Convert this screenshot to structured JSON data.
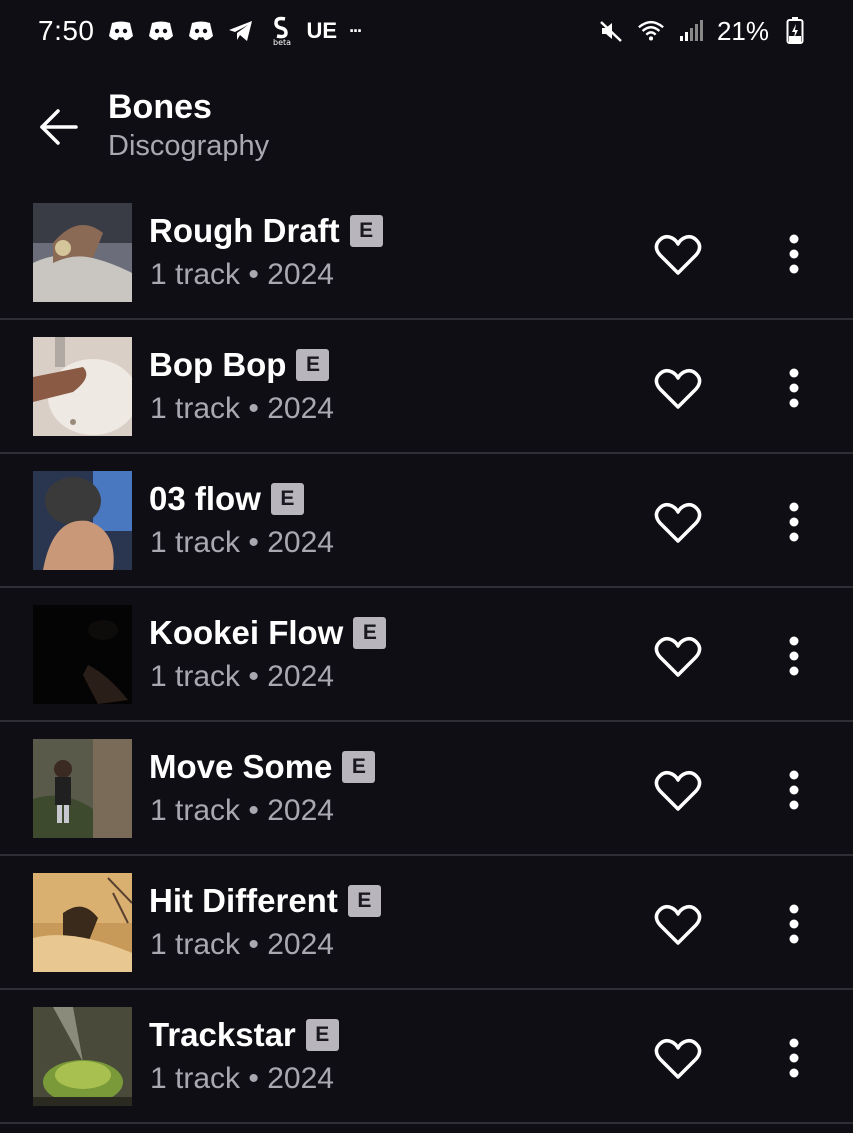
{
  "status": {
    "time": "7:50",
    "carrier_text": "UE",
    "overflow": "···",
    "battery_percent": "21%",
    "icons": [
      "discord-icon",
      "discord-icon",
      "discord-icon",
      "telegram-icon",
      "shazam-beta-icon",
      "mute-icon",
      "wifi-icon",
      "signal-icon",
      "battery-icon"
    ]
  },
  "header": {
    "title": "Bones",
    "subtitle": "Discography"
  },
  "explicit_label": "E",
  "releases": [
    {
      "title": "Rough Draft",
      "meta": "1 track • 2024",
      "explicit": true
    },
    {
      "title": "Bop Bop",
      "meta": "1 track • 2024",
      "explicit": true
    },
    {
      "title": "03 flow",
      "meta": "1 track • 2024",
      "explicit": true
    },
    {
      "title": "Kookei Flow",
      "meta": "1 track • 2024",
      "explicit": true
    },
    {
      "title": "Move Some",
      "meta": "1 track • 2024",
      "explicit": true
    },
    {
      "title": "Hit Different",
      "meta": "1 track • 2024",
      "explicit": true
    },
    {
      "title": "Trackstar",
      "meta": "1 track • 2024",
      "explicit": true
    }
  ],
  "colors": {
    "background": "#0f0e14",
    "divider": "#2f2e36",
    "secondary_text": "#a9a7b0",
    "explicit_badge": "#b8b6bc"
  }
}
